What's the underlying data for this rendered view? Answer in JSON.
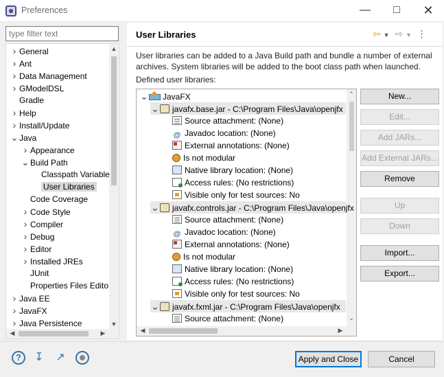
{
  "window": {
    "title": "Preferences"
  },
  "filter": {
    "placeholder": "type filter text"
  },
  "nav": {
    "items": [
      {
        "label": "General",
        "chevron": "right"
      },
      {
        "label": "Ant",
        "chevron": "right"
      },
      {
        "label": "Data Management",
        "chevron": "right"
      },
      {
        "label": "GModelDSL",
        "chevron": "right"
      },
      {
        "label": "Gradle",
        "chevron": ""
      },
      {
        "label": "Help",
        "chevron": "right"
      },
      {
        "label": "Install/Update",
        "chevron": "right"
      },
      {
        "label": "Java",
        "chevron": "down"
      },
      {
        "label": "Appearance",
        "chevron": "right"
      },
      {
        "label": "Build Path",
        "chevron": "down"
      },
      {
        "label": "Classpath Variable",
        "chevron": ""
      },
      {
        "label": "User Libraries",
        "chevron": "",
        "selected": true
      },
      {
        "label": "Code Coverage",
        "chevron": ""
      },
      {
        "label": "Code Style",
        "chevron": "right"
      },
      {
        "label": "Compiler",
        "chevron": "right"
      },
      {
        "label": "Debug",
        "chevron": "right"
      },
      {
        "label": "Editor",
        "chevron": "right"
      },
      {
        "label": "Installed JREs",
        "chevron": "right"
      },
      {
        "label": "JUnit",
        "chevron": ""
      },
      {
        "label": "Properties Files Edito",
        "chevron": ""
      },
      {
        "label": "Java EE",
        "chevron": "right"
      },
      {
        "label": "JavaFX",
        "chevron": "right"
      },
      {
        "label": "Java Persistence",
        "chevron": "right"
      }
    ]
  },
  "main": {
    "title": "User Libraries",
    "description": "User libraries can be added to a Java Build path and bundle a number of external archives. System libraries will be added to the boot class path when launched.",
    "defined_label": "Defined user libraries:",
    "tree": {
      "library": "JavaFX",
      "jars": [
        {
          "label": "javafx.base.jar - C:\\Program Files\\Java\\openjfx",
          "attributes": [
            "Source attachment: (None)",
            "Javadoc location: (None)",
            "External annotations: (None)",
            "Is not modular",
            "Native library location: (None)",
            "Access rules: (No restrictions)",
            "Visible only for test sources: No"
          ]
        },
        {
          "label": "javafx.controls.jar - C:\\Program Files\\Java\\openjfx",
          "attributes": [
            "Source attachment: (None)",
            "Javadoc location: (None)",
            "External annotations: (None)",
            "Is not modular",
            "Native library location: (None)",
            "Access rules: (No restrictions)",
            "Visible only for test sources: No"
          ]
        },
        {
          "label": "javafx.fxml.jar - C:\\Program Files\\Java\\openjfx",
          "attributes": [
            "Source attachment: (None)"
          ]
        }
      ]
    },
    "buttons": {
      "new": "New...",
      "edit": "Edit...",
      "add_jars": "Add JARs...",
      "add_external_jars": "Add External JARs...",
      "remove": "Remove",
      "up": "Up",
      "down": "Down",
      "import": "Import...",
      "export": "Export..."
    }
  },
  "footer": {
    "apply_close": "Apply and Close",
    "cancel": "Cancel"
  },
  "colors": {
    "default_button_border": "#0078d7",
    "selection": "#d9d9d9"
  }
}
